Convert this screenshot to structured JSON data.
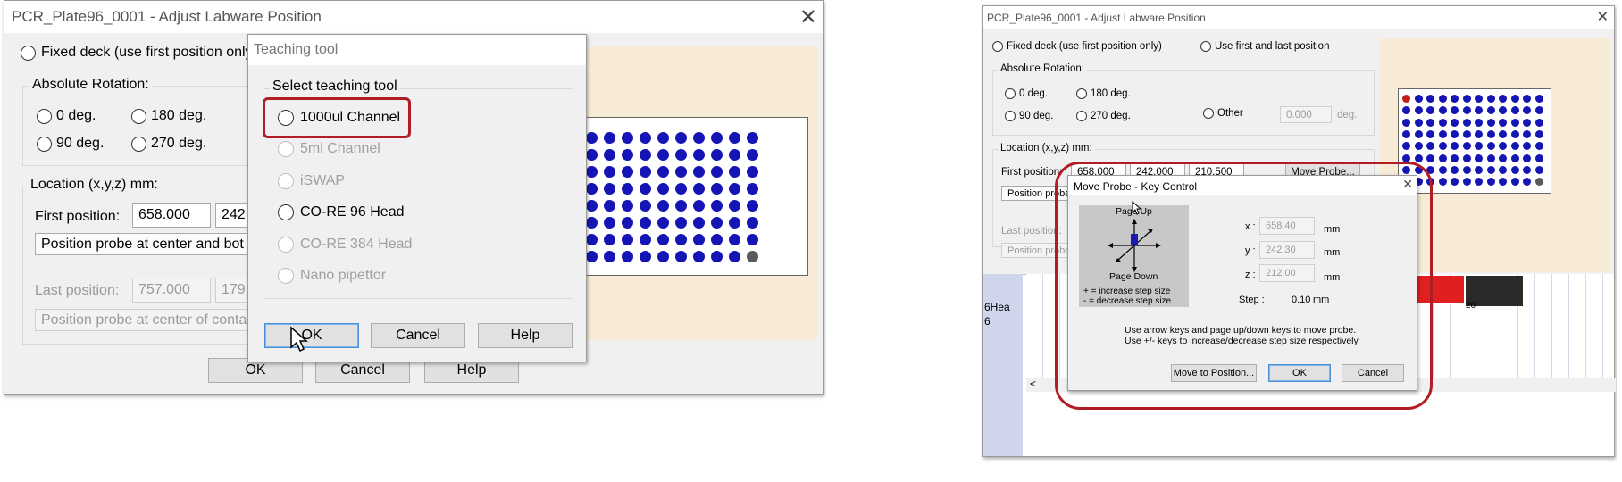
{
  "colors": {
    "highlight": "#b01d24",
    "well": "#1515b5",
    "well_empty": "#5a5a5a",
    "well_marker": "#c41d1d",
    "preview_bg": "#f7ebd7"
  },
  "left": {
    "title": "PCR_Plate96_0001 - Adjust Labware Position",
    "fixed_deck": "Fixed deck (use first position only",
    "rotation_label": "Absolute Rotation:",
    "rot": [
      "0 deg.",
      "180 deg.",
      "90 deg.",
      "270 deg."
    ],
    "location_label": "Location (x,y,z) mm:",
    "first_label": "First position:",
    "first_x": "658.000",
    "first_y": "242.",
    "first_hint": "Position probe at center and bot",
    "last_label": "Last position:",
    "last_x": "757.000",
    "last_y": "179.",
    "last_hint": "Position probe at center of conta",
    "ok": "OK",
    "cancel": "Cancel",
    "help": "Help",
    "teach": {
      "title": "Teaching tool",
      "group": "Select teaching tool",
      "options": [
        "1000ul Channel",
        "5ml Channel",
        "iSWAP",
        "CO-RE 96 Head",
        "CO-RE 384 Head",
        "Nano pipettor"
      ],
      "ok": "OK",
      "cancel": "Cancel",
      "help": "Help"
    }
  },
  "right": {
    "title": "PCR_Plate96_0001 - Adjust Labware Position",
    "fixed_deck": "Fixed deck (use first position only)",
    "first_last": "Use first and last position",
    "rotation_label": "Absolute Rotation:",
    "rot": [
      "0 deg.",
      "180 deg.",
      "90 deg.",
      "270 deg."
    ],
    "other": "Other",
    "other_value": "0.000",
    "deg": "deg.",
    "location_label": "Location (x,y,z) mm:",
    "first_label": "First position:",
    "first": [
      "658.000",
      "242.000",
      "210.500"
    ],
    "move_probe": "Move Probe...",
    "first_hint": "Position probe at center and bottom of container at first position",
    "last_label": "Last position:",
    "last_hint": "Position probe",
    "side_text": [
      "6Hea",
      "6"
    ],
    "deck_num": "20",
    "scroll_left": "<",
    "move": {
      "title": "Move Probe - Key Control",
      "page_up": "Page Up",
      "page_down": "Page Down",
      "inc": "+ = increase step size",
      "dec": "- = decrease step size",
      "x_label": "x :",
      "x": "658.40",
      "y_label": "y :",
      "y": "242.30",
      "z_label": "z :",
      "z": "212.00",
      "mm": "mm",
      "step_label": "Step :",
      "step": "0.10",
      "hint1": "Use arrow keys and page up/down keys to move probe.",
      "hint2": "Use +/- keys to increase/decrease step size respectively.",
      "move_to": "Move to Position...",
      "ok": "OK",
      "cancel": "Cancel"
    }
  }
}
